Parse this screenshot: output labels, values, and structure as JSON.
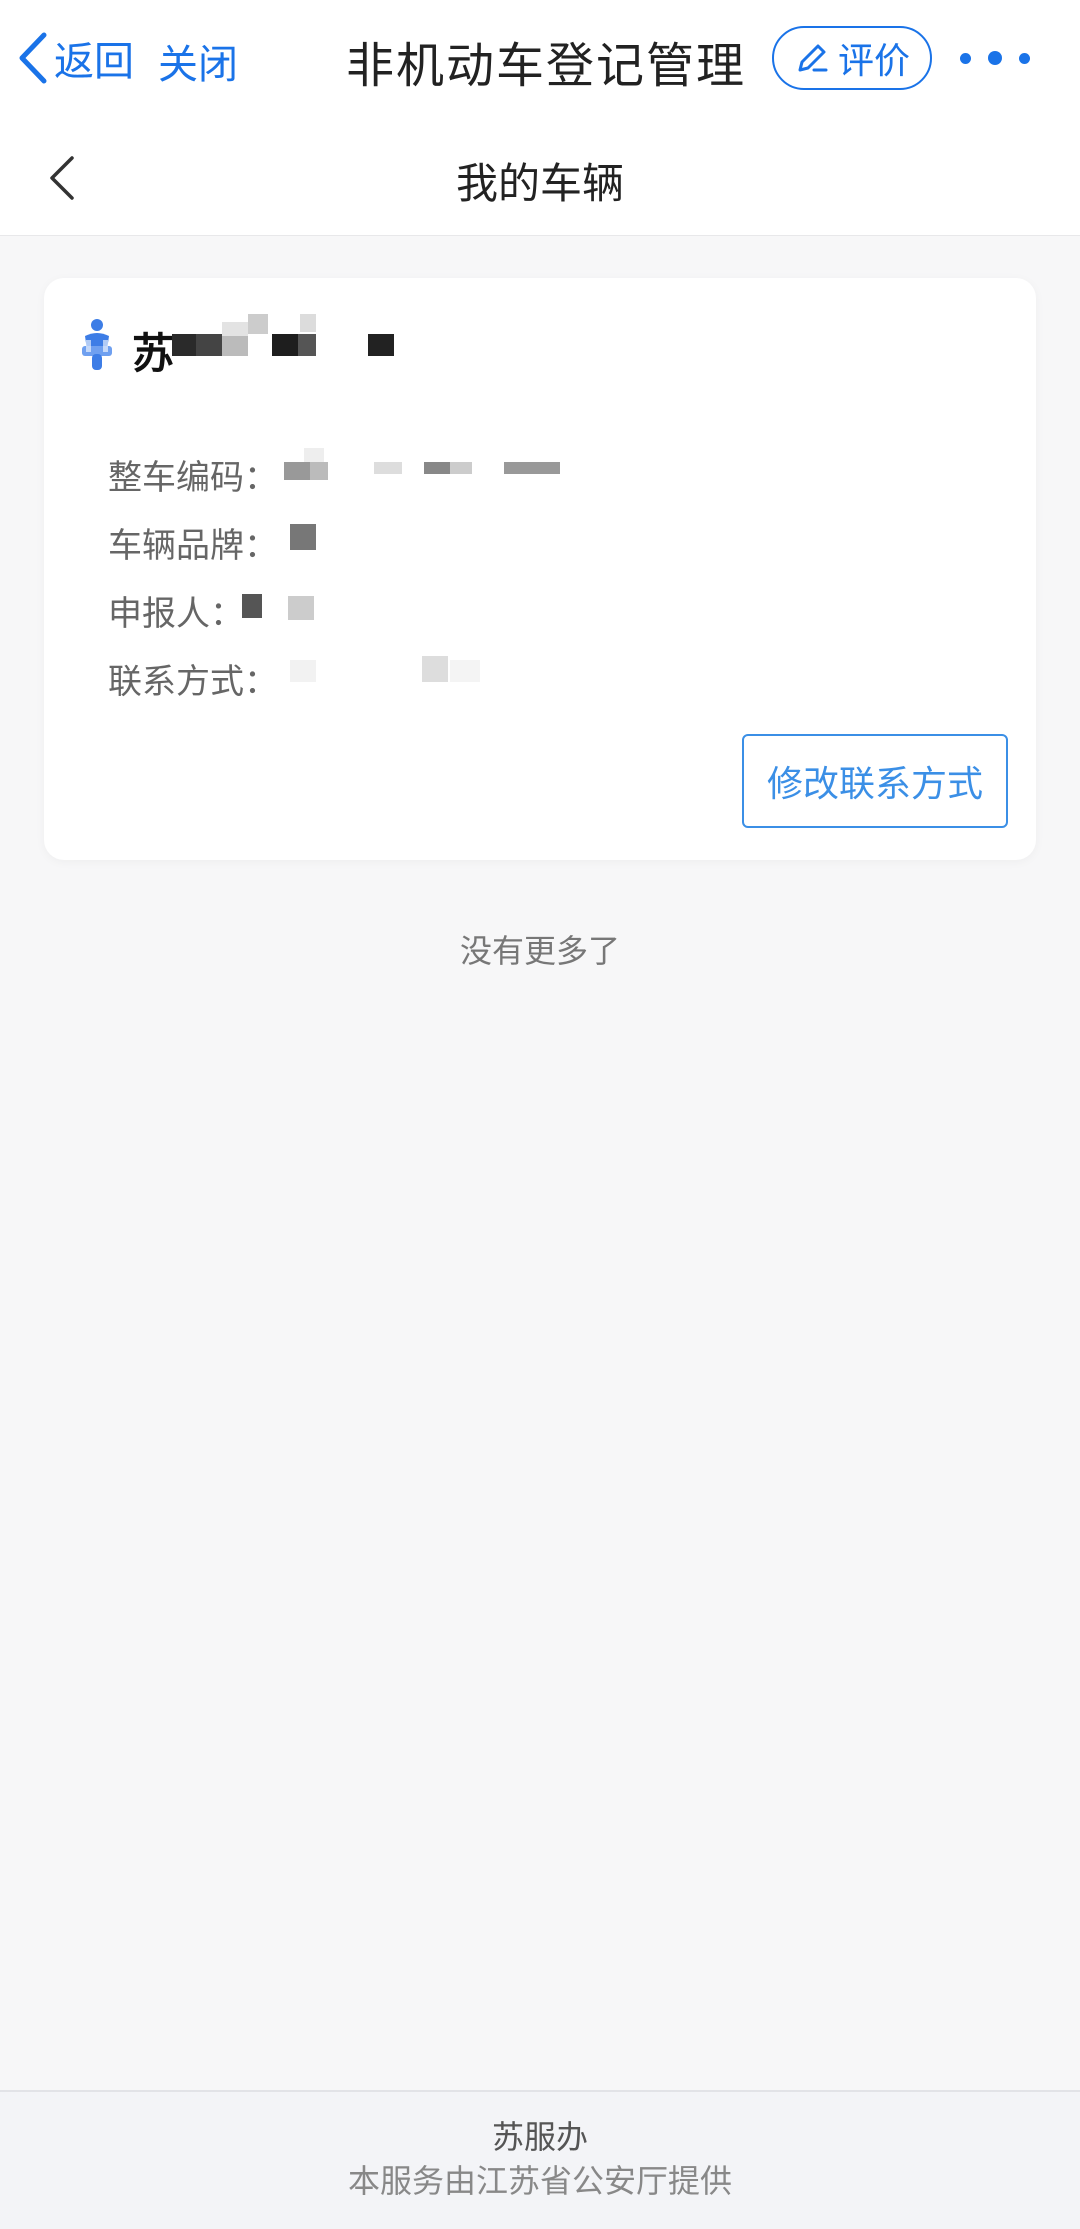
{
  "topbar": {
    "back_label": "返回",
    "close_label": "关闭",
    "title": "非机动车登记管理",
    "rate_label": "评价",
    "accent_color": "#1a73e8"
  },
  "navbar": {
    "title": "我的车辆"
  },
  "vehicle_card": {
    "plate_prefix": "苏",
    "fields": [
      {
        "label": "整车编码："
      },
      {
        "label": "车辆品牌："
      },
      {
        "label": "申报人："
      },
      {
        "label": "联系方式："
      }
    ],
    "edit_contact_label": "修改联系方式"
  },
  "list_end_text": "没有更多了",
  "footer": {
    "brand": "苏服办",
    "provider": "本服务由江苏省公安厅提供"
  },
  "icons": {
    "back": "chevron-left-icon",
    "rate": "edit-pencil-icon",
    "more": "more-dots-icon",
    "vehicle": "scooter-rider-icon"
  }
}
